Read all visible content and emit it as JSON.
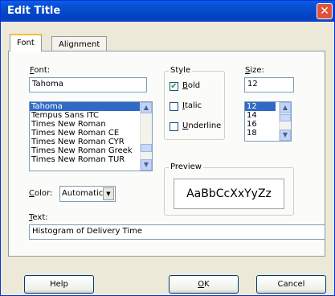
{
  "window": {
    "title": "Edit Title",
    "close_glyph": "✕"
  },
  "tabs": [
    {
      "label": "Font"
    },
    {
      "label": "Alignment"
    }
  ],
  "font": {
    "label_prefix": "",
    "label_key": "F",
    "label_rest": "ont:",
    "value": "Tahoma",
    "list": [
      "Tahoma",
      "Tempus Sans ITC",
      "Times New Roman",
      "Times New Roman CE",
      "Times New Roman CYR",
      "Times New Roman Greek",
      "Times New Roman TUR"
    ],
    "selected_index": 0
  },
  "style": {
    "group_label": "Style",
    "bold": {
      "key": "B",
      "rest": "old",
      "checked": true
    },
    "italic": {
      "key": "I",
      "rest": "talic",
      "checked": false
    },
    "underline": {
      "key": "U",
      "rest": "nderline",
      "checked": false
    }
  },
  "size": {
    "label_key": "S",
    "label_rest": "ize:",
    "value": "12",
    "list": [
      "12",
      "14",
      "16",
      "18"
    ],
    "selected_index": 0
  },
  "color": {
    "label_key": "C",
    "label_rest": "olor:",
    "value": "Automatic"
  },
  "preview": {
    "group_label": "Preview",
    "sample": "AaBbCcXxYyZz"
  },
  "text": {
    "label_key": "T",
    "label_rest": "ext:",
    "value": "Histogram of Delivery Time"
  },
  "buttons": {
    "help": "Help",
    "ok_key": "O",
    "ok_rest": "K",
    "cancel": "Cancel"
  },
  "icons": {
    "scroll_up": "▲",
    "scroll_down": "▼",
    "check": "✔"
  }
}
